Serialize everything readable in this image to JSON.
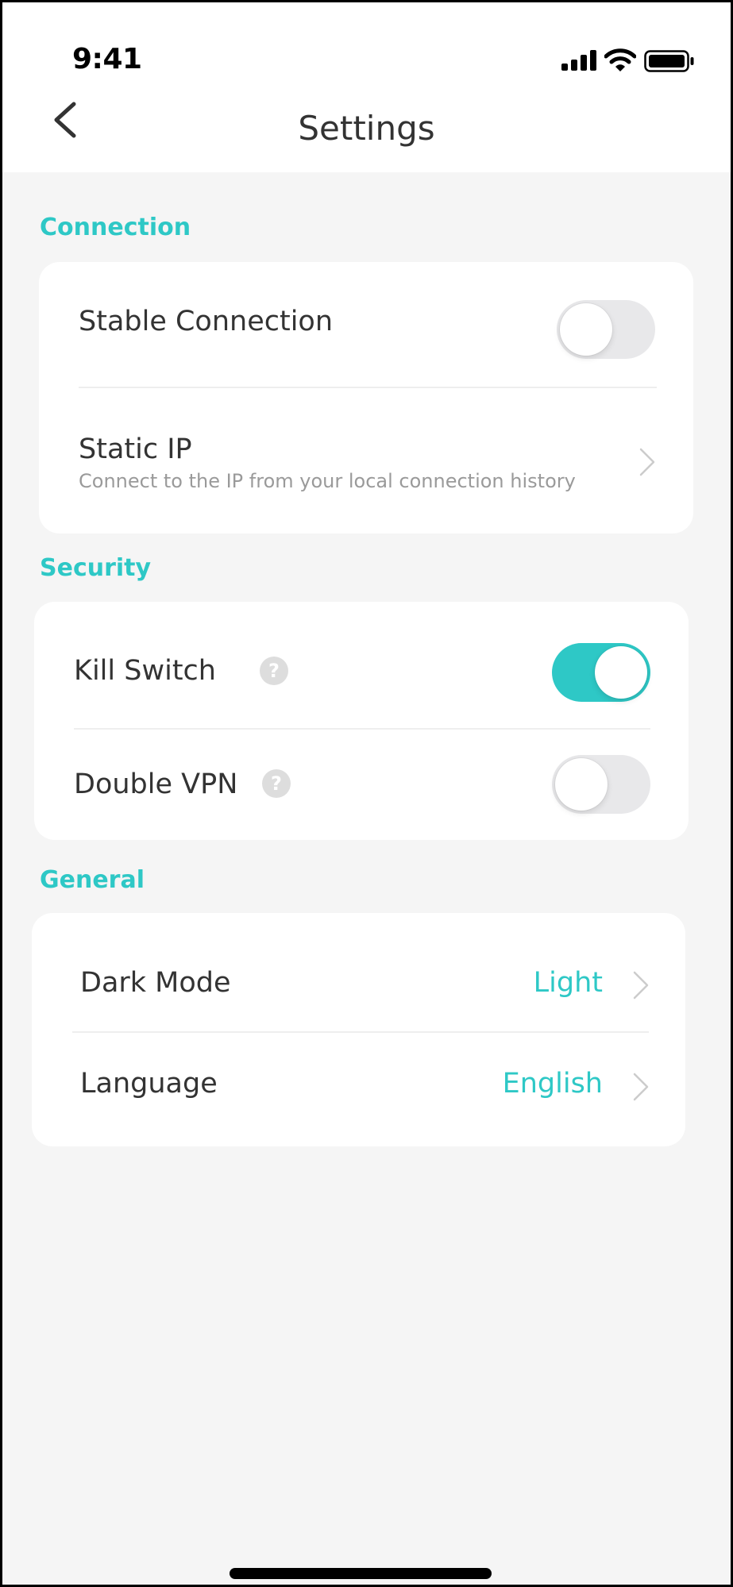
{
  "status_bar": {
    "time": "9:41",
    "icons": [
      "cellular-signal-icon",
      "wifi-icon",
      "battery-icon"
    ]
  },
  "header": {
    "back_icon": "chevron-left-icon",
    "title": "Settings"
  },
  "colors": {
    "accent": "#2ec8c6",
    "background": "#f5f5f5",
    "card": "#ffffff",
    "text_primary": "#333333",
    "text_secondary": "#9a9a9a",
    "toggle_off": "#e8e8ea"
  },
  "sections": {
    "connection": {
      "label": "Connection",
      "items": [
        {
          "label": "Stable Connection",
          "type": "toggle",
          "on": false
        },
        {
          "label": "Static IP",
          "subtitle": "Connect to the IP from your local connection history",
          "type": "link"
        }
      ]
    },
    "security": {
      "label": "Security",
      "items": [
        {
          "label": "Kill Switch",
          "help": "?",
          "type": "toggle",
          "on": true
        },
        {
          "label": "Double VPN",
          "help": "?",
          "type": "toggle",
          "on": false
        }
      ]
    },
    "general": {
      "label": "General",
      "items": [
        {
          "label": "Dark Mode",
          "value": "Light",
          "type": "link"
        },
        {
          "label": "Language",
          "value": "English",
          "type": "link"
        }
      ]
    }
  }
}
